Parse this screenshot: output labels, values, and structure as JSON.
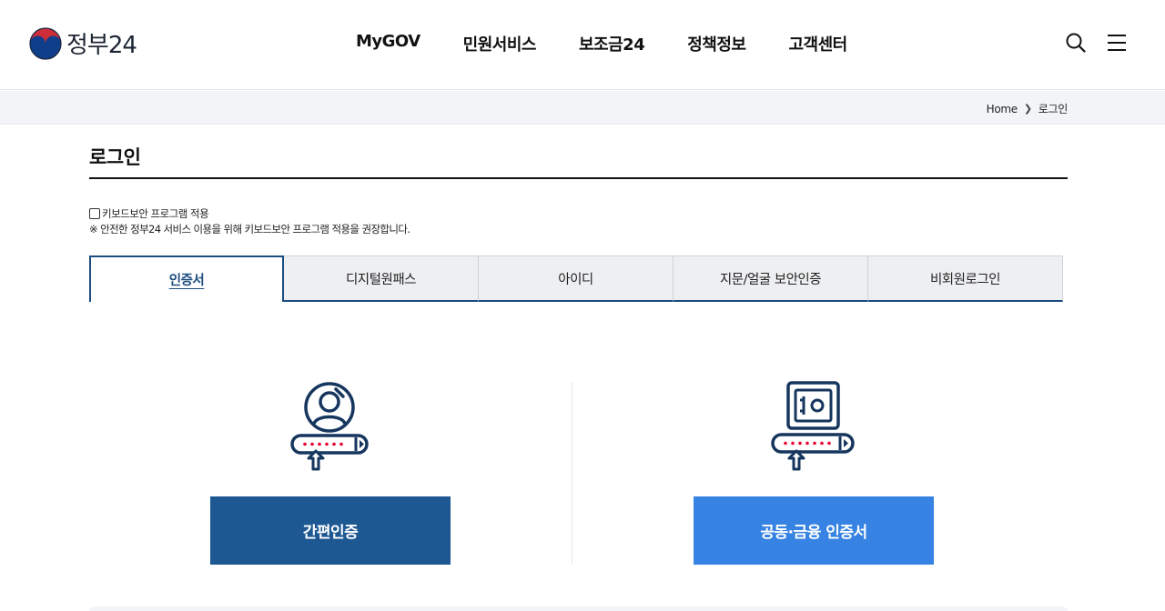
{
  "header": {
    "logo_text": "정부24",
    "nav": [
      "MyGOV",
      "민원서비스",
      "보조금24",
      "정책정보",
      "고객센터"
    ],
    "search_icon": "search-icon",
    "menu_icon": "hamburger-menu-icon"
  },
  "breadcrumb": {
    "home": "Home",
    "current": "로그인"
  },
  "page": {
    "title": "로그인"
  },
  "keyboard_security": {
    "label": "키보드보안 프로그램 적용",
    "checked": false,
    "note": "※ 안전한 정부24 서비스 이용을 위해 키보드보안 프로그램 적용을 권장합니다."
  },
  "tabs": [
    {
      "label": "인증서",
      "active": true
    },
    {
      "label": "디지털원패스",
      "active": false
    },
    {
      "label": "아이디",
      "active": false
    },
    {
      "label": "지문/얼굴 보안인증",
      "active": false
    },
    {
      "label": "비회원로그인",
      "active": false
    }
  ],
  "login_options": {
    "simple_auth_label": "간편인증",
    "cert_auth_label": "공동·금융 인증서"
  },
  "colors": {
    "navy": "#1d4d80",
    "simple_button": "#1d5893",
    "cert_button": "#3683e3",
    "dot_red": "#e6002d",
    "logo_red": "#cd2e3a",
    "logo_blue": "#0f3f8a"
  }
}
